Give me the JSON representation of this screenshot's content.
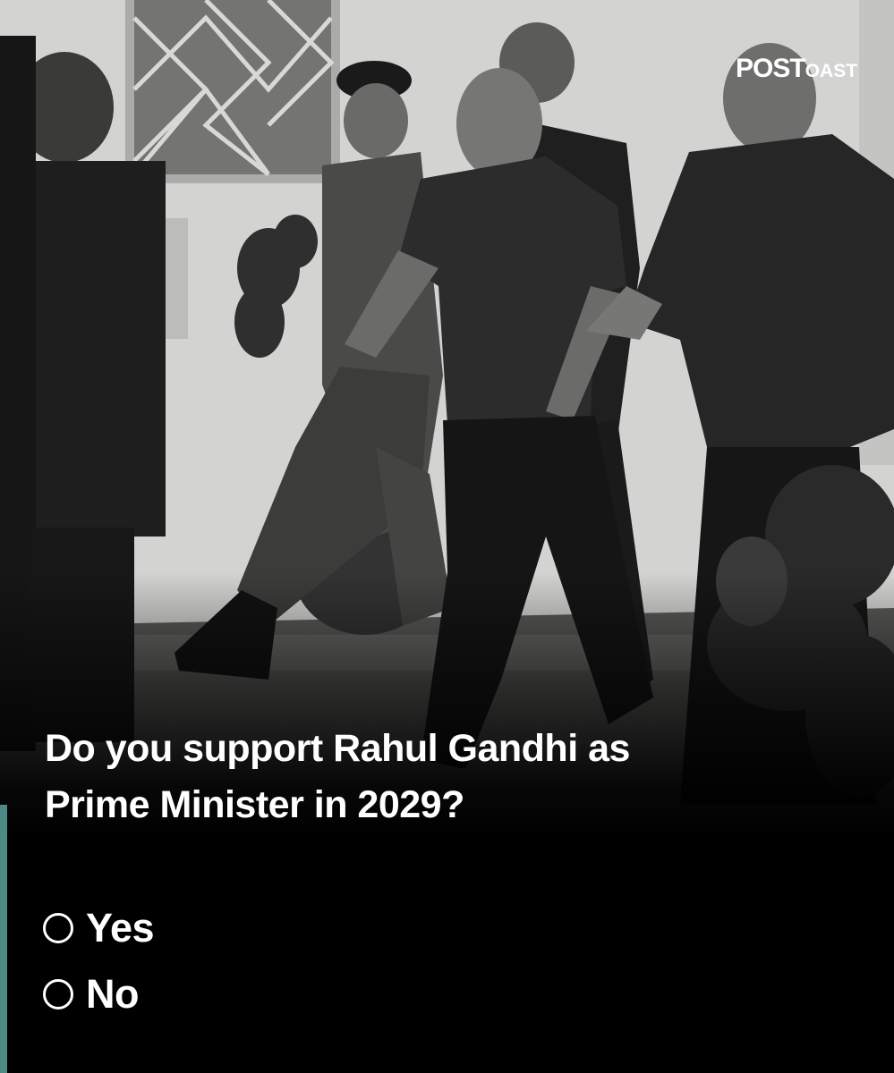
{
  "brand": {
    "logo_primary": "POST",
    "logo_secondary": "OAST"
  },
  "poll": {
    "question_line1": "Do you support Rahul Gandhi as",
    "question_line2": "Prime Minister in 2029?",
    "options": [
      {
        "label": "Yes",
        "selected": false
      },
      {
        "label": "No",
        "selected": false
      }
    ]
  },
  "colors": {
    "background": "#000000",
    "text": "#ffffff",
    "accent": "#4d8a86"
  }
}
